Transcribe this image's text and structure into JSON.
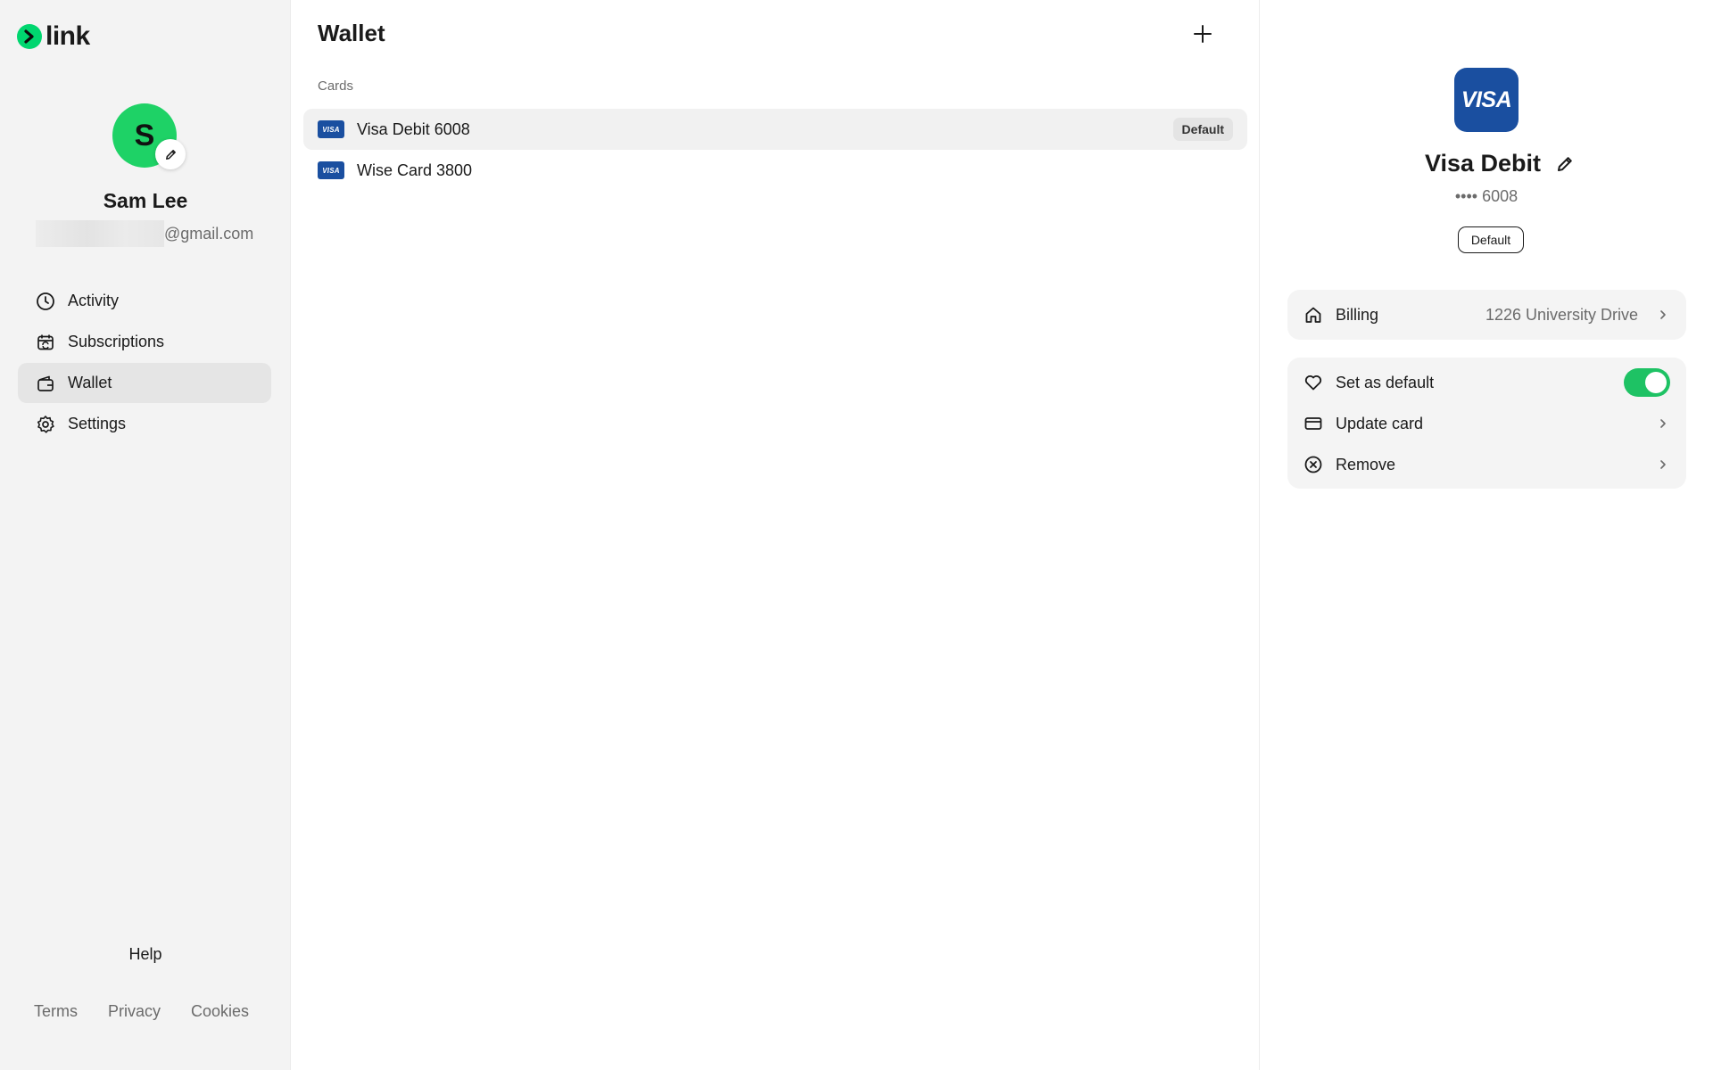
{
  "app": {
    "brand": "link",
    "brand_color": "#00d66f"
  },
  "user": {
    "initial": "S",
    "name": "Sam Lee",
    "email_suffix": "@gmail.com"
  },
  "nav": {
    "items": [
      {
        "label": "Activity",
        "icon": "clock-icon"
      },
      {
        "label": "Subscriptions",
        "icon": "calendar-refresh-icon"
      },
      {
        "label": "Wallet",
        "icon": "wallet-icon",
        "active": true
      },
      {
        "label": "Settings",
        "icon": "gear-icon"
      }
    ]
  },
  "footer": {
    "help": "Help",
    "terms": "Terms",
    "privacy": "Privacy",
    "cookies": "Cookies"
  },
  "main": {
    "title": "Wallet",
    "section_label": "Cards",
    "cards": [
      {
        "brand": "VISA",
        "name": "Visa Debit 6008",
        "badge": "Default",
        "selected": true
      },
      {
        "brand": "VISA",
        "name": "Wise Card 3800"
      }
    ]
  },
  "detail": {
    "brand": "VISA",
    "title": "Visa Debit",
    "number": "•••• 6008",
    "default_badge": "Default",
    "billing": {
      "label": "Billing",
      "value": "1226 University Drive"
    },
    "actions": {
      "set_default": {
        "label": "Set as default",
        "enabled": true
      },
      "update_card": "Update card",
      "remove": "Remove"
    },
    "toggle_color": "#1ec264",
    "visa_color": "#1a4fa0"
  }
}
